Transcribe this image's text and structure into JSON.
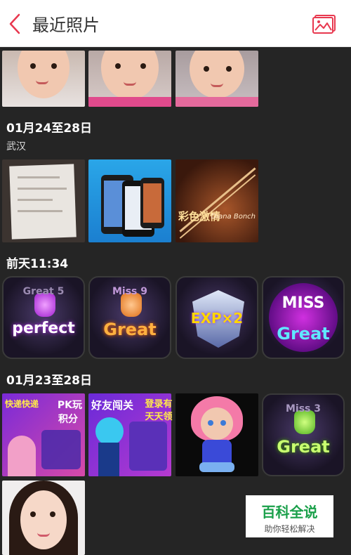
{
  "header": {
    "title": "最近照片"
  },
  "sections": [
    {
      "title": "01月24至28日",
      "location": "武汉"
    },
    {
      "title": "前天11:34"
    },
    {
      "title": "01月23至28日"
    }
  ],
  "tiles": {
    "perfect": {
      "top": "Great 5",
      "main": "perfect"
    },
    "great9": {
      "top": "Miss 9",
      "main": "Great"
    },
    "exp": {
      "main": "EXP×2"
    },
    "missgreat": {
      "top": "MISS",
      "main": "Great"
    },
    "miss3": {
      "top": "Miss 3",
      "main": "Great"
    },
    "pk": {
      "a": "快递快递",
      "b": "PK玩",
      "c": "积分"
    },
    "friends": {
      "a": "好友闯关"
    },
    "login": {
      "a": "登录有",
      "b": "天天领"
    },
    "violin": {
      "a": "彩色激情",
      "b": "Diana Bonch"
    }
  },
  "watermark": {
    "main": "百科全说",
    "sub": "助你轻松解决"
  },
  "colors": {
    "accent": "#e8384f",
    "background": "#252525",
    "header": "#ffffff"
  }
}
